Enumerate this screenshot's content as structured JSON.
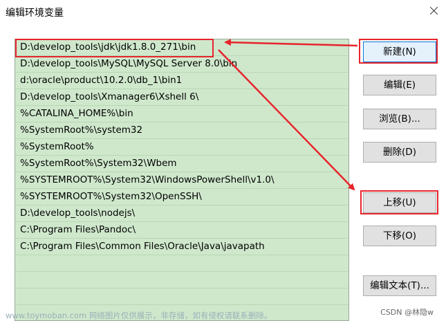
{
  "window": {
    "title": "编辑环境变量"
  },
  "path_list": {
    "items": [
      {
        "value": "D:\\develop_tools\\jdk\\jdk1.8.0_271\\bin"
      },
      {
        "value": "D:\\develop_tools\\MySQL\\MySQL Server 8.0\\bin"
      },
      {
        "value": "d:\\oracle\\product\\10.2.0\\db_1\\bin1"
      },
      {
        "value": "D:\\develop_tools\\Xmanager6\\Xshell 6\\"
      },
      {
        "value": "%CATALINA_HOME%\\bin"
      },
      {
        "value": "%SystemRoot%\\system32"
      },
      {
        "value": "%SystemRoot%"
      },
      {
        "value": "%SystemRoot%\\System32\\Wbem"
      },
      {
        "value": "%SYSTEMROOT%\\System32\\WindowsPowerShell\\v1.0\\"
      },
      {
        "value": "%SYSTEMROOT%\\System32\\OpenSSH\\"
      },
      {
        "value": "D:\\develop_tools\\nodejs\\"
      },
      {
        "value": "C:\\Program Files\\Pandoc\\"
      },
      {
        "value": "C:\\Program Files\\Common Files\\Oracle\\Java\\javapath"
      },
      {
        "value": ""
      },
      {
        "value": ""
      },
      {
        "value": ""
      },
      {
        "value": ""
      }
    ]
  },
  "buttons": {
    "new": "新建(N)",
    "edit": "编辑(E)",
    "browse": "浏览(B)...",
    "delete": "删除(D)",
    "move_up": "上移(U)",
    "move_down": "下移(O)",
    "edit_text": "编辑文本(T)..."
  },
  "watermark": "www.toymoban.com 网络图片仅供展示，非存储，如有侵权请联系删除。",
  "credit": "CSDN @林隐w",
  "colors": {
    "list_background": "#cfe8cc",
    "annotation_red": "#e8242c",
    "focused_button_border": "#0078d7"
  }
}
